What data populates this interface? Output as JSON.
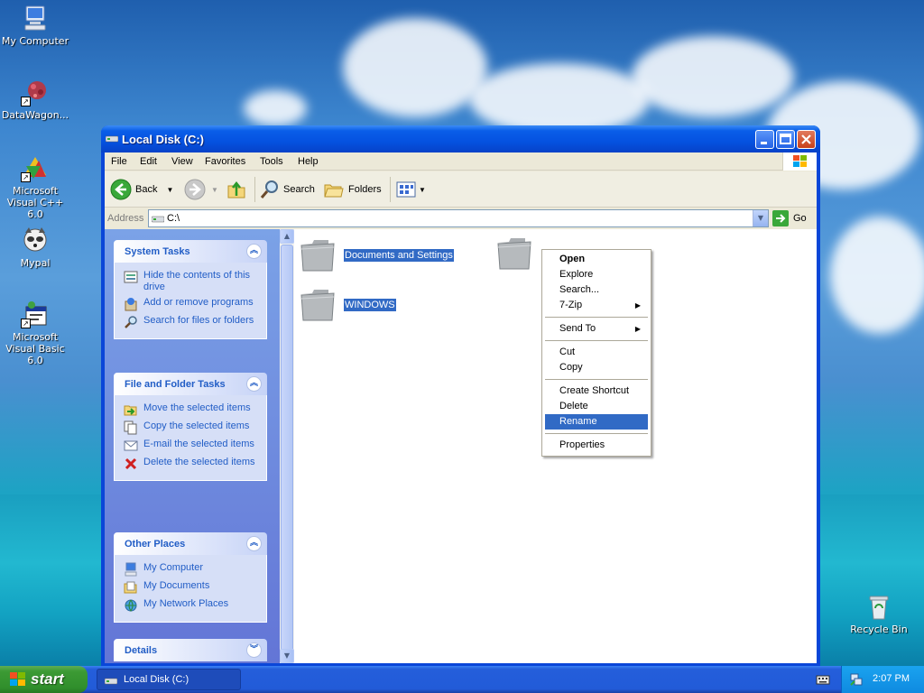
{
  "desktop": {
    "icons": [
      {
        "label": "My Computer"
      },
      {
        "label": "DataWagon..."
      },
      {
        "label": "Microsoft Visual C++ 6.0"
      },
      {
        "label": "Mypal"
      },
      {
        "label": "Microsoft Visual Basic 6.0"
      },
      {
        "label": "Recycle Bin"
      }
    ]
  },
  "window": {
    "title": "Local Disk (C:)",
    "menu": [
      "File",
      "Edit",
      "View",
      "Favorites",
      "Tools",
      "Help"
    ],
    "toolbar": {
      "back": "Back",
      "search": "Search",
      "folders": "Folders"
    },
    "address": {
      "label": "Address",
      "value": "C:\\",
      "go": "Go"
    }
  },
  "left_pane": {
    "system_tasks": {
      "title": "System Tasks",
      "items": [
        "Hide the contents of this drive",
        "Add or remove programs",
        "Search for files or folders"
      ]
    },
    "file_folder_tasks": {
      "title": "File and Folder Tasks",
      "items": [
        "Move the selected items",
        "Copy the selected items",
        "E-mail the selected items",
        "Delete the selected items"
      ]
    },
    "other_places": {
      "title": "Other Places",
      "items": [
        "My Computer",
        "My Documents",
        "My Network Places"
      ]
    },
    "details": {
      "title": "Details"
    }
  },
  "content": {
    "folders": [
      "Documents and Settings",
      "WINDOWS"
    ]
  },
  "context_menu": {
    "items": [
      "Open",
      "Explore",
      "Search...",
      "7-Zip",
      "Send To",
      "Cut",
      "Copy",
      "Create Shortcut",
      "Delete",
      "Rename",
      "Properties"
    ],
    "highlighted": "Rename"
  },
  "taskbar": {
    "start": "start",
    "task_button": "Local Disk (C:)",
    "clock": "2:07 PM"
  },
  "colors": {
    "accent": "#316ac5",
    "title_blue": "#0a46d8",
    "task_link": "#215dc6"
  }
}
